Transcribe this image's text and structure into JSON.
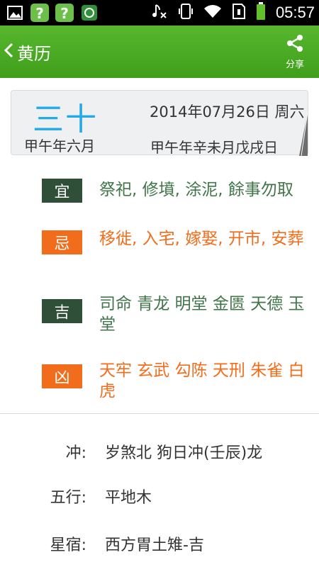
{
  "status_bar": {
    "time": "05:57",
    "left_icons": [
      "image-icon",
      "help-app-icon",
      "help-app-icon",
      "shield-app-icon"
    ],
    "right_icons": [
      "music-off-icon",
      "vibrate-icon",
      "wifi-icon",
      "sim-icon",
      "battery-icon"
    ]
  },
  "titlebar": {
    "title": "黄历",
    "share_label": "分享",
    "color": "#4caf24"
  },
  "date_card": {
    "lunar_day": "三十",
    "lunar_month": "甲午年六月",
    "solar_date": "2014年07月26日  周六",
    "ganzhi": "甲午年辛未月戊戌日"
  },
  "rows": [
    {
      "tag": "宜",
      "text": "祭祀, 修墳, 涂泥, 餘事勿取",
      "tone": "green"
    },
    {
      "tag": "忌",
      "text": "移徙, 入宅, 嫁娶, 开市, 安葬",
      "tone": "orange"
    },
    {
      "tag": "吉",
      "text": "司命 青龙 明堂 金匮 天德 玉堂",
      "tone": "green"
    },
    {
      "tag": "凶",
      "text": "天牢 玄武 勾陈 天刑 朱雀 白虎",
      "tone": "orange"
    }
  ],
  "info": [
    {
      "label": "冲:",
      "value": "岁煞北 狗日冲(壬辰)龙"
    },
    {
      "label": "五行:",
      "value": "平地木"
    },
    {
      "label": "星宿:",
      "value": "西方胃土雉-吉"
    }
  ],
  "colors": {
    "accent_green": "#2f4f38",
    "accent_orange": "#f26d1b",
    "lunar_blue": "#27a9e6"
  }
}
